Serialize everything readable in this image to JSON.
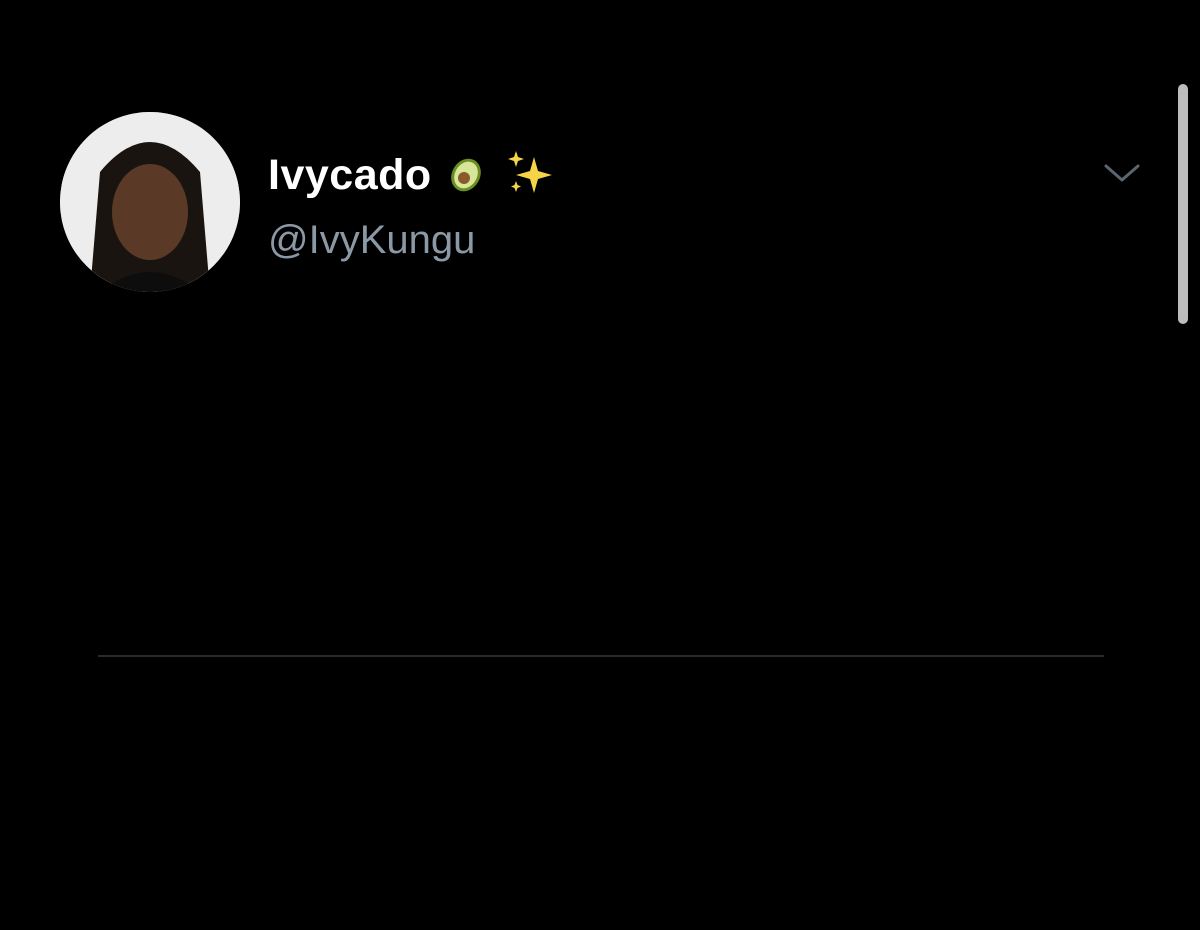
{
  "tweet": {
    "author": {
      "display_name": "Ivycado",
      "handle": "@IvyKungu",
      "name_emojis": [
        "avocado-icon",
        "sparkles-icon"
      ]
    },
    "text": ""
  },
  "colors": {
    "background": "#000000",
    "primary_text": "#ffffff",
    "secondary_text": "#8b98a5",
    "divider": "#2a2a2a"
  }
}
